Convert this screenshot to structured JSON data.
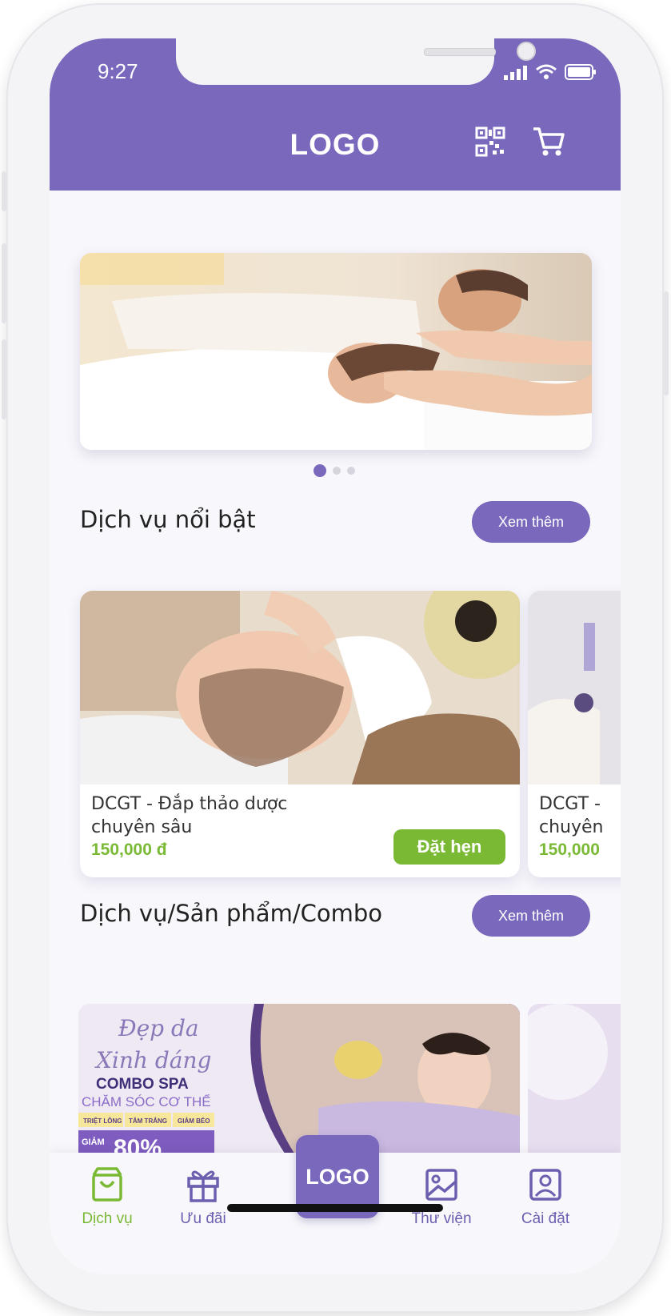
{
  "status_bar": {
    "time": "9:27"
  },
  "header": {
    "logo": "LOGO",
    "qr_icon": "qr-code-icon",
    "cart_icon": "cart-icon"
  },
  "banner": {
    "image": "couple-massage-photo",
    "slides": 3,
    "active_slide": 1
  },
  "featured": {
    "title": "Dịch vụ nổi bật",
    "more_label": "Xem thêm",
    "items": [
      {
        "name_line1": "DCGT - Đắp thảo dược",
        "name_line2": "chuyên sâu",
        "price": "150,000 đ",
        "book_label": "Đặt hẹn"
      },
      {
        "name_line1": "DCGT -",
        "name_line2": "chuyên",
        "price": "150,000"
      }
    ]
  },
  "combo_section": {
    "title": "Dịch vụ/Sản phẩm/Combo",
    "more_label": "Xem thêm",
    "promo": {
      "script_line1": "Đẹp da",
      "script_line2": "Xinh dáng",
      "headline": "COMBO SPA",
      "subheadline": "CHĂM SÓC CƠ THỂ",
      "tags": [
        "TRIỆT LÔNG",
        "TẮM TRẮNG",
        "GIẢM BÉO"
      ],
      "discount_prefix": "GIẢM",
      "discount_value": "80%"
    }
  },
  "tabbar": {
    "tabs": [
      {
        "label": "Dịch vụ",
        "icon": "shopping-bag-icon",
        "active": true
      },
      {
        "label": "Ưu đãi",
        "icon": "gift-icon",
        "active": false
      },
      {
        "label": "Thư viện",
        "icon": "image-icon",
        "active": false
      },
      {
        "label": "Cài đặt",
        "icon": "user-portrait-icon",
        "active": false
      }
    ],
    "center_logo": "LOGO"
  },
  "colors": {
    "primary": "#7a68bd",
    "accent": "#7ab934",
    "background": "#f8f7fb"
  }
}
